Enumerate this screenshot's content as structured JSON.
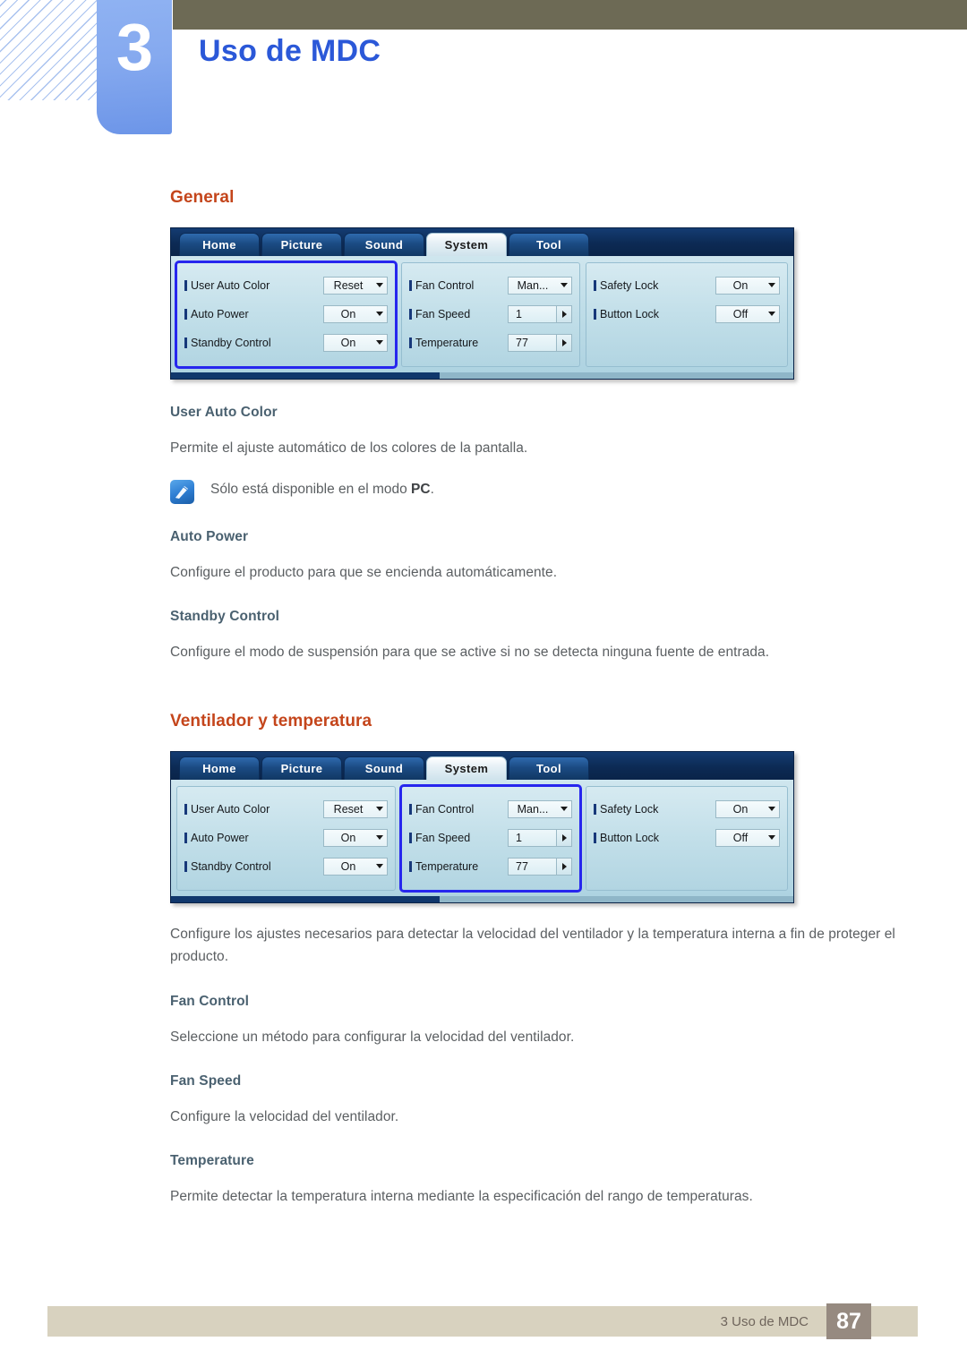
{
  "header": {
    "chapter_number": "3",
    "chapter_title": "Uso de MDC"
  },
  "sections": [
    {
      "heading": "General",
      "subsections": [
        {
          "title": "User Auto Color",
          "body": "Permite el ajuste automático de los colores de la pantalla."
        },
        {
          "title": "Auto Power",
          "body": "Configure el producto para que se encienda automáticamente."
        },
        {
          "title": "Standby Control",
          "body": "Configure el modo de suspensión para que se active si no se detecta ninguna fuente de entrada."
        }
      ],
      "note": {
        "icon": "note-pen-icon",
        "text_before": "Sólo está disponible en el modo ",
        "text_bold": "PC",
        "text_after": "."
      }
    },
    {
      "heading": "Ventilador y temperatura",
      "intro": "Configure los ajustes necesarios para detectar la velocidad del ventilador y la temperatura interna a fin de proteger el producto.",
      "subsections": [
        {
          "title": "Fan Control",
          "body": "Seleccione un método para configurar la velocidad del ventilador."
        },
        {
          "title": "Fan Speed",
          "body": "Configure la velocidad del ventilador."
        },
        {
          "title": "Temperature",
          "body": "Permite detectar la temperatura interna mediante la especificación del rango de temperaturas."
        }
      ]
    }
  ],
  "mdc_window": {
    "tabs": [
      {
        "label": "Home",
        "active": false
      },
      {
        "label": "Picture",
        "active": false
      },
      {
        "label": "Sound",
        "active": false
      },
      {
        "label": "System",
        "active": true
      },
      {
        "label": "Tool",
        "active": false
      }
    ],
    "panels": {
      "general": [
        {
          "label": "User Auto Color",
          "value": "Reset",
          "control": "dropdown"
        },
        {
          "label": "Auto Power",
          "value": "On",
          "control": "dropdown"
        },
        {
          "label": "Standby Control",
          "value": "On",
          "control": "dropdown"
        }
      ],
      "fan": [
        {
          "label": "Fan Control",
          "value": "Man...",
          "control": "dropdown"
        },
        {
          "label": "Fan Speed",
          "value": "1",
          "control": "spinner"
        },
        {
          "label": "Temperature",
          "value": "77",
          "control": "spinner"
        }
      ],
      "lock": [
        {
          "label": "Safety Lock",
          "value": "On",
          "control": "dropdown"
        },
        {
          "label": "Button Lock",
          "value": "Off",
          "control": "dropdown"
        }
      ]
    },
    "highlight_first": "general",
    "highlight_second": "fan"
  },
  "footer": {
    "label": "3 Uso de MDC",
    "page": "87"
  },
  "colors": {
    "chapter_title": "#2b58d8",
    "section_heading": "#c4451b",
    "sub_heading": "#4a6170",
    "body_text": "#5b5f62",
    "olive_band": "#6d6a55",
    "badge_blue": "#85a9ef",
    "footer_bar": "#d8d2bf",
    "footer_page_box": "#968a80",
    "highlight_border": "#2626ee"
  }
}
